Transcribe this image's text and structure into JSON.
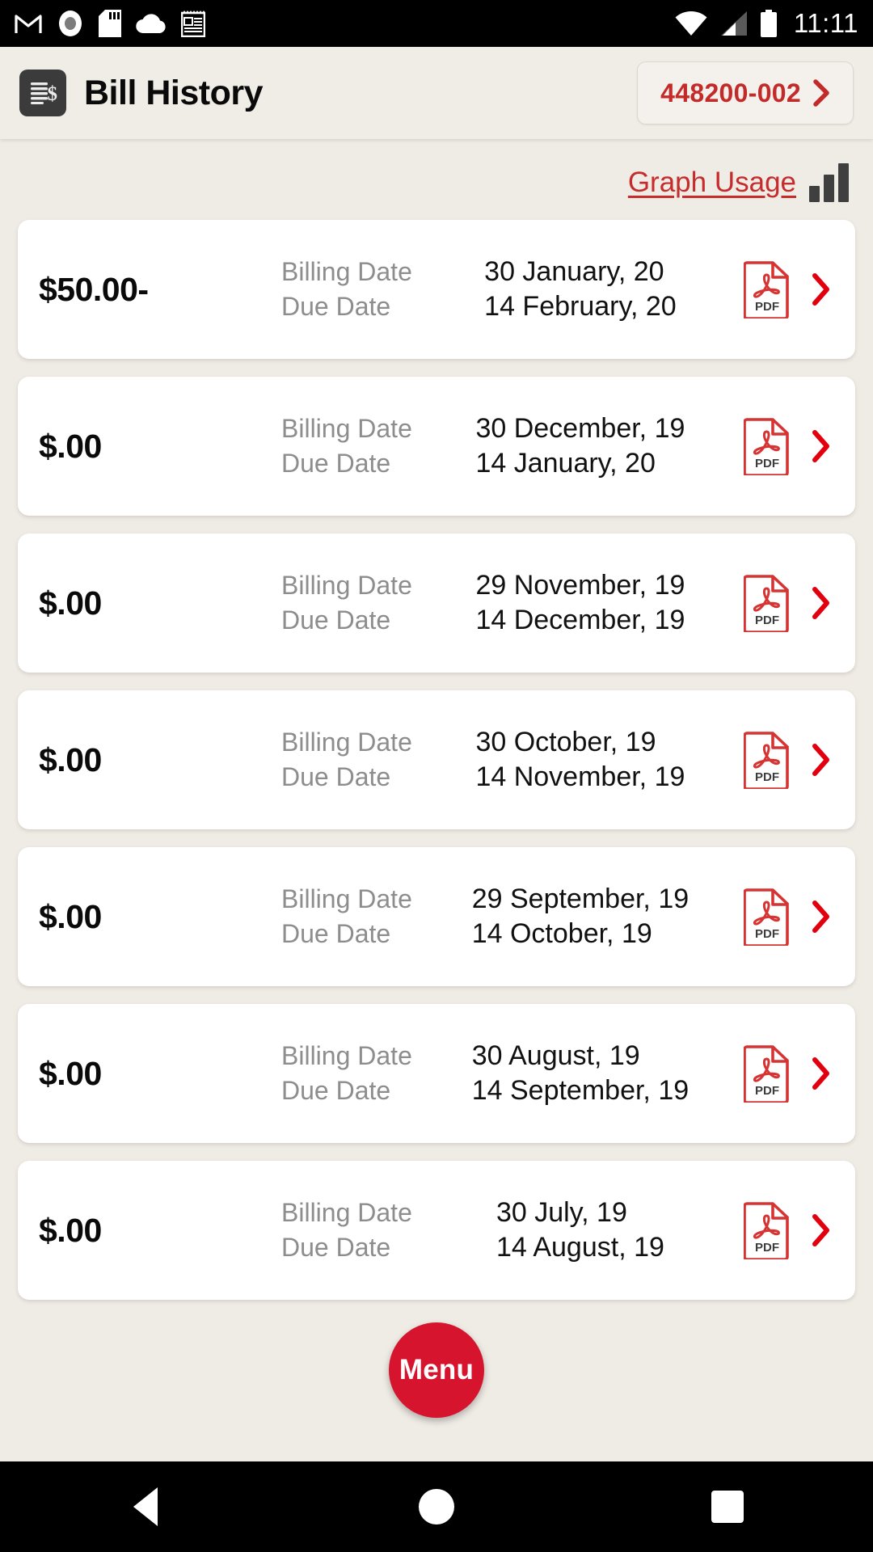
{
  "status_bar": {
    "time": "11:11",
    "left_icons": [
      "gmail-icon",
      "record-dot-icon",
      "sd-card-icon",
      "cloud-icon",
      "news-notepad-icon"
    ],
    "right_icons": [
      "wifi-icon",
      "cell-signal-icon",
      "battery-icon"
    ]
  },
  "header": {
    "app_icon": "invoice-dollar-icon",
    "title": "Bill History",
    "account_number": "448200-002",
    "account_chevron": "chevron-right-icon"
  },
  "toolbar": {
    "graph_usage_label": "Graph Usage",
    "graph_icon": "bar-chart-icon"
  },
  "labels": {
    "billing_date": "Billing Date",
    "due_date": "Due Date",
    "pdf_icon": "pdf-file-icon",
    "row_chevron": "chevron-right-icon"
  },
  "bills": [
    {
      "amount": "$50.00-",
      "billing_date": "30 January, 20",
      "due_date": "14 February, 20"
    },
    {
      "amount": "$.00",
      "billing_date": "30 December, 19",
      "due_date": "14 January, 20"
    },
    {
      "amount": "$.00",
      "billing_date": "29 November, 19",
      "due_date": "14 December, 19"
    },
    {
      "amount": "$.00",
      "billing_date": "30 October, 19",
      "due_date": "14 November, 19"
    },
    {
      "amount": "$.00",
      "billing_date": "29 September, 19",
      "due_date": "14 October, 19"
    },
    {
      "amount": "$.00",
      "billing_date": "30 August, 19",
      "due_date": "14 September, 19"
    },
    {
      "amount": "$.00",
      "billing_date": "30 July, 19",
      "due_date": "14 August, 19"
    }
  ],
  "fab": {
    "label": "Menu"
  },
  "nav_bar": {
    "back": "back-triangle-icon",
    "home": "home-circle-icon",
    "recents": "recents-square-icon"
  },
  "colors": {
    "brand_red": "#c62c2c",
    "fab_red": "#d6142d",
    "page_bg": "#efebe5",
    "card_bg": "#ffffff",
    "label_gray": "#8d8d8d",
    "icon_dark": "#3b3b3b"
  }
}
